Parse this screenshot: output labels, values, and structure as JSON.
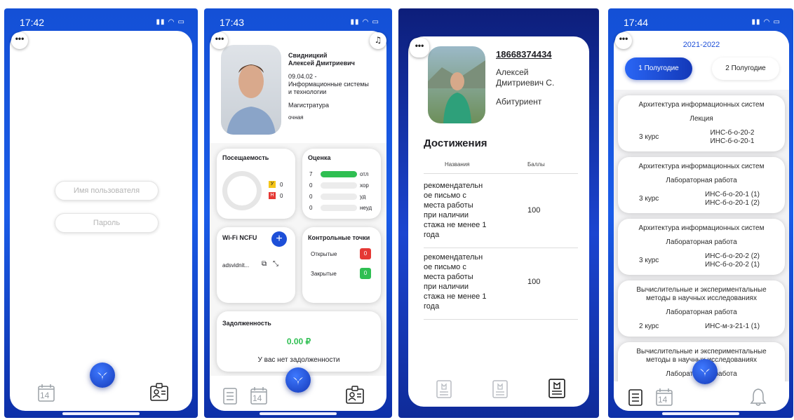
{
  "screen1": {
    "time": "17:42",
    "username_placeholder": "Имя пользователя",
    "password_placeholder": "Пароль",
    "nav_calendar_day": "14"
  },
  "screen2": {
    "time": "17:43",
    "name_line1": "Свидницкий",
    "name_line2": "Алексей Дмитриевич",
    "program_lines": [
      "09.04.02 -",
      "Информационные системы",
      "и технологии"
    ],
    "level": "Магистратура",
    "form": "очная",
    "attendance": {
      "title": "Посещаемость",
      "y_label": "У",
      "y_value": "0",
      "n_label": "Н",
      "n_value": "0"
    },
    "grades": {
      "title": "Оценка",
      "rows": [
        {
          "count": "7",
          "label": "отл",
          "fill": 1.0
        },
        {
          "count": "0",
          "label": "хор",
          "fill": 0
        },
        {
          "count": "0",
          "label": "уд",
          "fill": 0
        },
        {
          "count": "0",
          "label": "неуд",
          "fill": 0
        }
      ]
    },
    "wifi": {
      "title": "Wi-Fi NCFU",
      "login": "adsvidnit..."
    },
    "checkpoints": {
      "title": "Контрольные точки",
      "open_label": "Открытые",
      "open_count": "0",
      "closed_label": "Закрытые",
      "closed_count": "0"
    },
    "debt": {
      "title": "Задолженность",
      "amount": "0.00 ₽",
      "note": "У вас нет задолженности"
    },
    "nav_calendar_day": "14",
    "colors": {
      "green": "#2fbf52",
      "red": "#e53935",
      "yellow": "#f5c518"
    }
  },
  "screen3": {
    "phone": "18668374434",
    "name_line1": "Алексей",
    "name_line2": "Дмитриевич С.",
    "status": "Абитуриент",
    "section_title": "Достижения",
    "col_name": "Названия",
    "col_score": "Баллы",
    "rows": [
      {
        "lines": [
          "рекомендательн",
          "ое письмо с",
          "места работы",
          "при наличии",
          "стажа не менее 1",
          "года"
        ],
        "score": "100"
      },
      {
        "lines": [
          "рекомендательн",
          "ое письмо с",
          "места работы",
          "при наличии",
          "стажа не менее 1",
          "года"
        ],
        "score": "100"
      }
    ]
  },
  "screen4": {
    "time": "17:44",
    "year": "2021-2022",
    "tab1": "1 Полугодие",
    "tab2": "2 Полугодие",
    "subjects": [
      {
        "title_lines": [
          "Архитектура информационных систем"
        ],
        "type": "Лекция",
        "course": "3 курс",
        "groups": [
          "ИНС-б-о-20-2",
          "ИНС-б-о-20-1"
        ]
      },
      {
        "title_lines": [
          "Архитектура информационных систем"
        ],
        "type": "Лабораторная работа",
        "course": "3 курс",
        "groups": [
          "ИНС-б-о-20-1 (1)",
          "ИНС-б-о-20-1 (2)"
        ]
      },
      {
        "title_lines": [
          "Архитектура информационных систем"
        ],
        "type": "Лабораторная работа",
        "course": "3 курс",
        "groups": [
          "ИНС-б-о-20-2 (2)",
          "ИНС-б-о-20-2 (1)"
        ]
      },
      {
        "title_lines": [
          "Вычислительные и экспериментальные",
          "методы в научных исследованиях"
        ],
        "type": "Лабораторная работа",
        "course": "2 курс",
        "groups": [
          "ИНС-м-з-21-1 (1)"
        ]
      },
      {
        "title_lines": [
          "Вычислительные и экспериментальные",
          "методы в научных исследованиях"
        ],
        "type": "Лабораторная работа",
        "course": "",
        "groups": []
      }
    ],
    "nav_calendar_day": "14",
    "accent": "#1d4fd8"
  }
}
